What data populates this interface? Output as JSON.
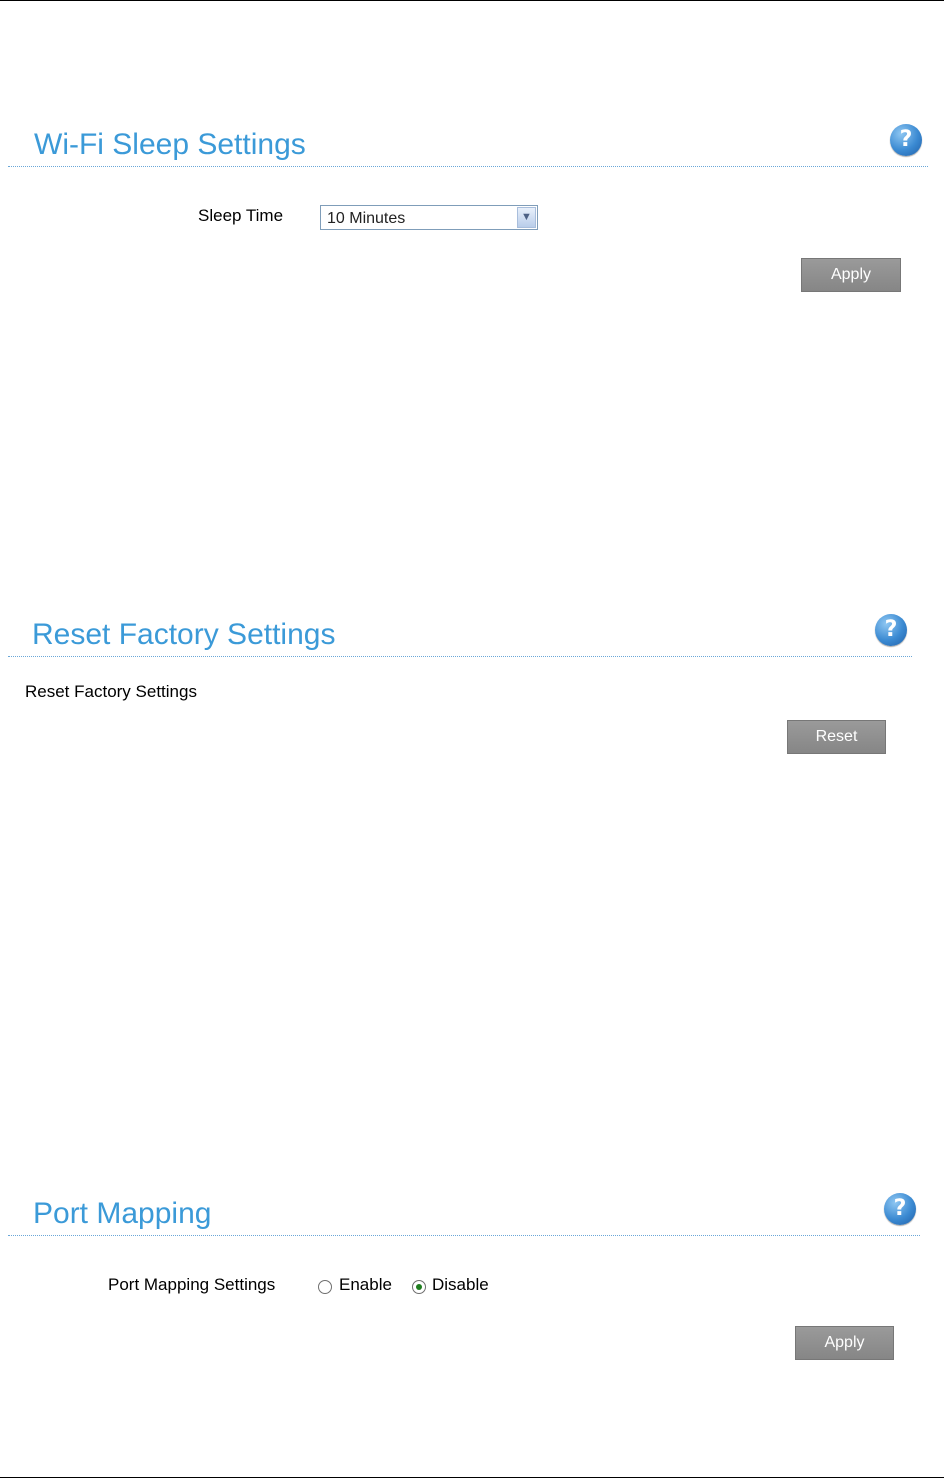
{
  "wifi_sleep": {
    "title": "Wi-Fi Sleep Settings",
    "help_glyph": "?",
    "sleep_time_label": "Sleep Time",
    "sleep_time_value": "10 Minutes",
    "dropdown_glyph": "▼",
    "apply_label": "Apply"
  },
  "reset_factory": {
    "title": "Reset Factory Settings",
    "help_glyph": "?",
    "description": "Reset Factory Settings",
    "reset_label": "Reset"
  },
  "port_mapping": {
    "title": "Port Mapping",
    "help_glyph": "?",
    "settings_label": "Port Mapping Settings",
    "options": [
      "Enable",
      "Disable"
    ],
    "selected_option": "Disable",
    "apply_label": "Apply"
  },
  "theme": {
    "title_color": "#3b9ad8",
    "help_icon_color": "#3b8ad2",
    "button_color": "#8c8c8c",
    "radio_checked_color": "#1e7d1e"
  }
}
